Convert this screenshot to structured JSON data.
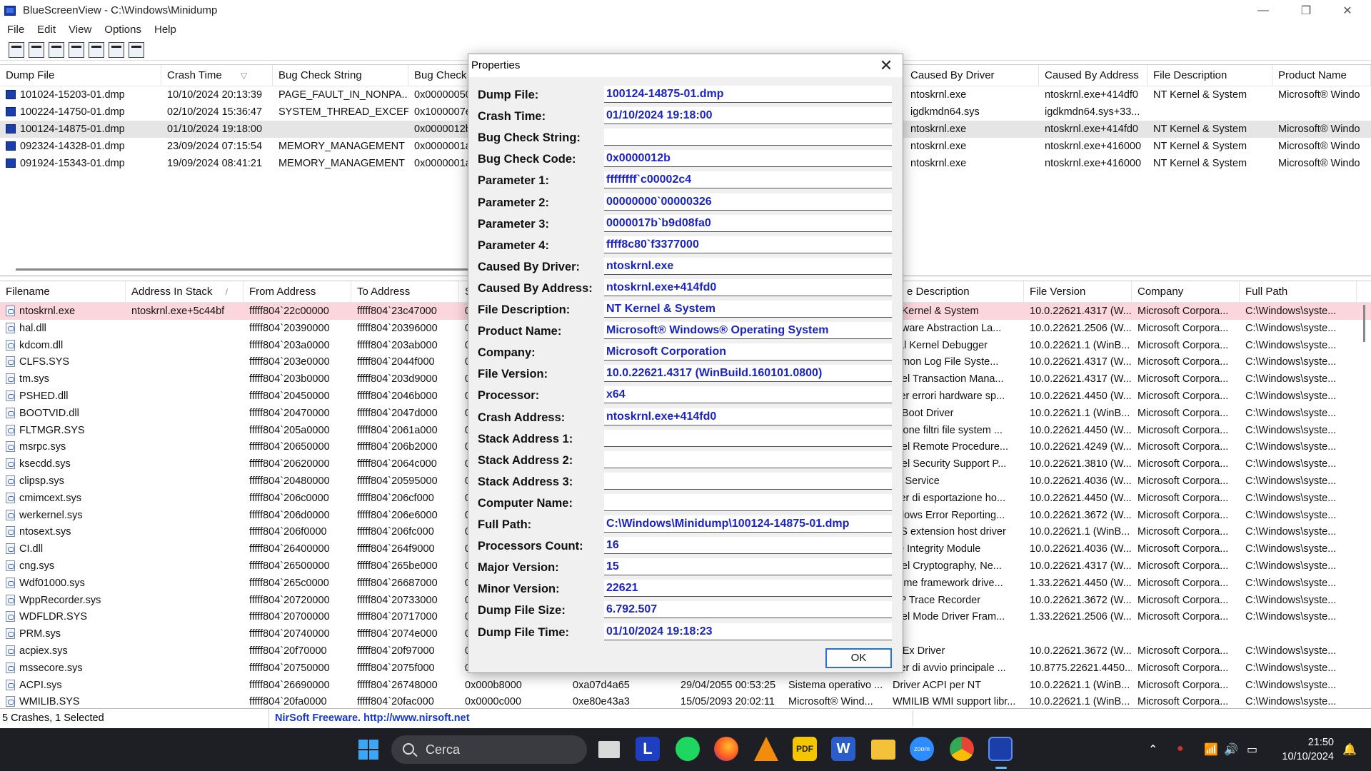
{
  "window": {
    "title": "BlueScreenView  -  C:\\Windows\\Minidump",
    "minimize": "—",
    "maximize": "❐",
    "close": "✕"
  },
  "menu": [
    "File",
    "Edit",
    "View",
    "Options",
    "Help"
  ],
  "toolbar_icons": [
    "properties-icon",
    "save-icon",
    "refresh-icon",
    "copy-icon",
    "html-report-icon",
    "find-icon",
    "exit-icon"
  ],
  "upper": {
    "headers": [
      "Dump File",
      "Crash Time",
      "Bug Check String",
      "Bug Check C",
      "Caused By Driver",
      "Caused By Address",
      "File Description",
      "Product Name"
    ],
    "sort_arrow": "▽",
    "rows": [
      {
        "dump": "101024-15203-01.dmp",
        "time": "10/10/2024 20:13:39",
        "bcs": "PAGE_FAULT_IN_NONPA...",
        "bcc": "0x00000050",
        "driver": "ntoskrnl.exe",
        "addr": "ntoskrnl.exe+414df0",
        "desc": "NT Kernel & System",
        "prod": "Microsoft® Windo"
      },
      {
        "dump": "100224-14750-01.dmp",
        "time": "02/10/2024 15:36:47",
        "bcs": "SYSTEM_THREAD_EXCEP...",
        "bcc": "0x1000007e",
        "driver": "igdkmdn64.sys",
        "addr": "igdkmdn64.sys+33...",
        "desc": "",
        "prod": ""
      },
      {
        "dump": "100124-14875-01.dmp",
        "time": "01/10/2024 19:18:00",
        "bcs": "",
        "bcc": "0x0000012b",
        "driver": "ntoskrnl.exe",
        "addr": "ntoskrnl.exe+414fd0",
        "desc": "NT Kernel & System",
        "prod": "Microsoft® Windo"
      },
      {
        "dump": "092324-14328-01.dmp",
        "time": "23/09/2024 07:15:54",
        "bcs": "MEMORY_MANAGEMENT",
        "bcc": "0x0000001a",
        "driver": "ntoskrnl.exe",
        "addr": "ntoskrnl.exe+416000",
        "desc": "NT Kernel & System",
        "prod": "Microsoft® Windo"
      },
      {
        "dump": "091924-15343-01.dmp",
        "time": "19/09/2024 08:41:21",
        "bcs": "MEMORY_MANAGEMENT",
        "bcc": "0x0000001a",
        "driver": "ntoskrnl.exe",
        "addr": "ntoskrnl.exe+416000",
        "desc": "NT Kernel & System",
        "prod": "Microsoft® Windo"
      }
    ]
  },
  "lower": {
    "headers": [
      "Filename",
      "Address In Stack",
      "From Address",
      "To Address",
      "S",
      "e Description",
      "File Version",
      "Company",
      "Full Path"
    ],
    "sort_arrow": "/",
    "rows": [
      {
        "file": "ntoskrnl.exe",
        "stack": "ntoskrnl.exe+5c44bf",
        "from": "fffff804`22c00000",
        "to": "fffff804`23c47000",
        "s": "0",
        "size": "",
        "ts": "",
        "fdesc": "",
        "desc": "T Kernel & System",
        "ver": "10.0.22621.4317 (W...",
        "comp": "Microsoft Corpora...",
        "path": "C:\\Windows\\syste..."
      },
      {
        "file": "hal.dll",
        "stack": "",
        "from": "fffff804`20390000",
        "to": "fffff804`20396000",
        "s": "0",
        "size": "",
        "ts": "",
        "fdesc": "",
        "desc": "rdware Abstraction La...",
        "ver": "10.0.22621.2506 (W...",
        "comp": "Microsoft Corpora...",
        "path": "C:\\Windows\\syste..."
      },
      {
        "file": "kdcom.dll",
        "stack": "",
        "from": "fffff804`203a0000",
        "to": "fffff804`203ab000",
        "s": "0",
        "size": "",
        "ts": "",
        "fdesc": "",
        "desc": "rial Kernel Debugger",
        "ver": "10.0.22621.1 (WinB...",
        "comp": "Microsoft Corpora...",
        "path": "C:\\Windows\\syste..."
      },
      {
        "file": "CLFS.SYS",
        "stack": "",
        "from": "fffff804`203e0000",
        "to": "fffff804`2044f000",
        "s": "0",
        "size": "",
        "ts": "",
        "fdesc": "",
        "desc": "mmon Log File Syste...",
        "ver": "10.0.22621.4317 (W...",
        "comp": "Microsoft Corpora...",
        "path": "C:\\Windows\\syste..."
      },
      {
        "file": "tm.sys",
        "stack": "",
        "from": "fffff804`203b0000",
        "to": "fffff804`203d9000",
        "s": "0",
        "size": "",
        "ts": "",
        "fdesc": "",
        "desc": "rnel Transaction Mana...",
        "ver": "10.0.22621.4317 (W...",
        "comp": "Microsoft Corpora...",
        "path": "C:\\Windows\\syste..."
      },
      {
        "file": "PSHED.dll",
        "stack": "",
        "from": "fffff804`20450000",
        "to": "fffff804`2046b000",
        "s": "0",
        "size": "",
        "ts": "",
        "fdesc": "",
        "desc": "iver errori hardware sp...",
        "ver": "10.0.22621.4450 (W...",
        "comp": "Microsoft Corpora...",
        "path": "C:\\Windows\\syste..."
      },
      {
        "file": "BOOTVID.dll",
        "stack": "",
        "from": "fffff804`20470000",
        "to": "fffff804`2047d000",
        "s": "0",
        "size": "",
        "ts": "",
        "fdesc": "",
        "desc": "A Boot Driver",
        "ver": "10.0.22621.1 (WinB...",
        "comp": "Microsoft Corpora...",
        "path": "C:\\Windows\\syste..."
      },
      {
        "file": "FLTMGR.SYS",
        "stack": "",
        "from": "fffff804`205a0000",
        "to": "fffff804`2061a000",
        "s": "0",
        "size": "",
        "ts": "",
        "fdesc": "",
        "desc": "stione filtri file system ...",
        "ver": "10.0.22621.4450 (W...",
        "comp": "Microsoft Corpora...",
        "path": "C:\\Windows\\syste..."
      },
      {
        "file": "msrpc.sys",
        "stack": "",
        "from": "fffff804`20650000",
        "to": "fffff804`206b2000",
        "s": "0",
        "size": "",
        "ts": "",
        "fdesc": "",
        "desc": "rnel Remote Procedure...",
        "ver": "10.0.22621.4249 (W...",
        "comp": "Microsoft Corpora...",
        "path": "C:\\Windows\\syste..."
      },
      {
        "file": "ksecdd.sys",
        "stack": "",
        "from": "fffff804`20620000",
        "to": "fffff804`2064c000",
        "s": "0",
        "size": "",
        "ts": "",
        "fdesc": "",
        "desc": "rnel Security Support P...",
        "ver": "10.0.22621.3810 (W...",
        "comp": "Microsoft Corpora...",
        "path": "C:\\Windows\\syste..."
      },
      {
        "file": "clipsp.sys",
        "stack": "",
        "from": "fffff804`20480000",
        "to": "fffff804`20595000",
        "s": "0",
        "size": "",
        "ts": "",
        "fdesc": "",
        "desc": "IP Service",
        "ver": "10.0.22621.4036 (W...",
        "comp": "Microsoft Corpora...",
        "path": "C:\\Windows\\syste..."
      },
      {
        "file": "cmimcext.sys",
        "stack": "",
        "from": "fffff804`206c0000",
        "to": "fffff804`206cf000",
        "s": "0",
        "size": "",
        "ts": "",
        "fdesc": "",
        "desc": "iver di esportazione ho...",
        "ver": "10.0.22621.4450 (W...",
        "comp": "Microsoft Corpora...",
        "path": "C:\\Windows\\syste..."
      },
      {
        "file": "werkernel.sys",
        "stack": "",
        "from": "fffff804`206d0000",
        "to": "fffff804`206e6000",
        "s": "0",
        "size": "",
        "ts": "",
        "fdesc": "",
        "desc": "ndows Error Reporting...",
        "ver": "10.0.22621.3672 (W...",
        "comp": "Microsoft Corpora...",
        "path": "C:\\Windows\\syste..."
      },
      {
        "file": "ntosext.sys",
        "stack": "",
        "from": "fffff804`206f0000",
        "to": "fffff804`206fc000",
        "s": "0",
        "size": "",
        "ts": "",
        "fdesc": "",
        "desc": "OS extension host driver",
        "ver": "10.0.22621.1 (WinB...",
        "comp": "Microsoft Corpora...",
        "path": "C:\\Windows\\syste..."
      },
      {
        "file": "CI.dll",
        "stack": "",
        "from": "fffff804`26400000",
        "to": "fffff804`264f9000",
        "s": "0",
        "size": "",
        "ts": "",
        "fdesc": "",
        "desc": "de Integrity Module",
        "ver": "10.0.22621.4036 (W...",
        "comp": "Microsoft Corpora...",
        "path": "C:\\Windows\\syste..."
      },
      {
        "file": "cng.sys",
        "stack": "",
        "from": "fffff804`26500000",
        "to": "fffff804`265be000",
        "s": "0",
        "size": "",
        "ts": "",
        "fdesc": "",
        "desc": "rnel Cryptography, Ne...",
        "ver": "10.0.22621.4317 (W...",
        "comp": "Microsoft Corpora...",
        "path": "C:\\Windows\\syste..."
      },
      {
        "file": "Wdf01000.sys",
        "stack": "",
        "from": "fffff804`265c0000",
        "to": "fffff804`26687000",
        "s": "0",
        "size": "",
        "ts": "",
        "fdesc": "",
        "desc": "ntime framework drive...",
        "ver": "1.33.22621.4450 (W...",
        "comp": "Microsoft Corpora...",
        "path": "C:\\Windows\\syste..."
      },
      {
        "file": "WppRecorder.sys",
        "stack": "",
        "from": "fffff804`20720000",
        "to": "fffff804`20733000",
        "s": "0",
        "size": "",
        "ts": "",
        "fdesc": "",
        "desc": "PP Trace Recorder",
        "ver": "10.0.22621.3672 (W...",
        "comp": "Microsoft Corpora...",
        "path": "C:\\Windows\\syste..."
      },
      {
        "file": "WDFLDR.SYS",
        "stack": "",
        "from": "fffff804`20700000",
        "to": "fffff804`20717000",
        "s": "0",
        "size": "",
        "ts": "",
        "fdesc": "",
        "desc": "rnel Mode Driver Fram...",
        "ver": "1.33.22621.2506 (W...",
        "comp": "Microsoft Corpora...",
        "path": "C:\\Windows\\syste..."
      },
      {
        "file": "PRM.sys",
        "stack": "",
        "from": "fffff804`20740000",
        "to": "fffff804`2074e000",
        "s": "0",
        "size": "",
        "ts": "",
        "fdesc": "",
        "desc": "",
        "ver": "",
        "comp": "",
        "path": ""
      },
      {
        "file": "acpiex.sys",
        "stack": "",
        "from": "fffff804`20f70000",
        "to": "fffff804`20f97000",
        "s": "0",
        "size": "",
        "ts": "",
        "fdesc": "",
        "desc": "PIEx Driver",
        "ver": "10.0.22621.3672 (W...",
        "comp": "Microsoft Corpora...",
        "path": "C:\\Windows\\syste..."
      },
      {
        "file": "mssecore.sys",
        "stack": "",
        "from": "fffff804`20750000",
        "to": "fffff804`2075f000",
        "s": "0",
        "size": "",
        "ts": "",
        "fdesc": "",
        "desc": "iver di avvio principale ...",
        "ver": "10.8775.22621.4450...",
        "comp": "Microsoft Corpora...",
        "path": "C:\\Windows\\syste..."
      },
      {
        "file": "ACPI.sys",
        "stack": "",
        "from": "fffff804`26690000",
        "to": "fffff804`26748000",
        "s": "0x000b8000",
        "size": "0xa07d4a65",
        "ts": "29/04/2055 00:53:25",
        "fdesc": "Sistema operativo ...",
        "desc": "Driver ACPI per NT",
        "ver": "10.0.22621.1 (WinB...",
        "comp": "Microsoft Corpora...",
        "path": "C:\\Windows\\syste..."
      },
      {
        "file": "WMILIB.SYS",
        "stack": "",
        "from": "fffff804`20fa0000",
        "to": "fffff804`20fac000",
        "s": "0x0000c000",
        "size": "0xe80e43a3",
        "ts": "15/05/2093 20:02:11",
        "fdesc": "Microsoft® Wind...",
        "desc": "WMILIB WMI support libr...",
        "ver": "10.0.22621.1 (WinB...",
        "comp": "Microsoft Corpora...",
        "path": "C:\\Windows\\syste..."
      }
    ]
  },
  "status": {
    "left": "5 Crashes, 1 Selected",
    "link": "NirSoft Freeware.  http://www.nirsoft.net"
  },
  "dialog": {
    "title": "Properties",
    "close": "✕",
    "ok": "OK",
    "props": [
      {
        "label": "Dump File:",
        "value": "100124-14875-01.dmp"
      },
      {
        "label": "Crash Time:",
        "value": "01/10/2024 19:18:00"
      },
      {
        "label": "Bug Check String:",
        "value": ""
      },
      {
        "label": "Bug Check Code:",
        "value": "0x0000012b"
      },
      {
        "label": "Parameter 1:",
        "value": "ffffffff`c00002c4"
      },
      {
        "label": "Parameter 2:",
        "value": "00000000`00000326"
      },
      {
        "label": "Parameter 3:",
        "value": "0000017b`b9d08fa0"
      },
      {
        "label": "Parameter 4:",
        "value": "ffff8c80`f3377000"
      },
      {
        "label": "Caused By Driver:",
        "value": "ntoskrnl.exe"
      },
      {
        "label": "Caused By Address:",
        "value": "ntoskrnl.exe+414fd0"
      },
      {
        "label": "File Description:",
        "value": "NT Kernel & System"
      },
      {
        "label": "Product Name:",
        "value": "Microsoft® Windows® Operating System"
      },
      {
        "label": "Company:",
        "value": "Microsoft Corporation"
      },
      {
        "label": "File Version:",
        "value": "10.0.22621.4317 (WinBuild.160101.0800)"
      },
      {
        "label": "Processor:",
        "value": "x64"
      },
      {
        "label": "Crash Address:",
        "value": "ntoskrnl.exe+414fd0"
      },
      {
        "label": "Stack Address 1:",
        "value": ""
      },
      {
        "label": "Stack Address 2:",
        "value": ""
      },
      {
        "label": "Stack Address 3:",
        "value": ""
      },
      {
        "label": "Computer Name:",
        "value": ""
      },
      {
        "label": "Full Path:",
        "value": "C:\\Windows\\Minidump\\100124-14875-01.dmp"
      },
      {
        "label": "Processors Count:",
        "value": "16"
      },
      {
        "label": "Major Version:",
        "value": "15"
      },
      {
        "label": "Minor Version:",
        "value": "22621"
      },
      {
        "label": "Dump File Size:",
        "value": "6.792.507"
      },
      {
        "label": "Dump File Time:",
        "value": "01/10/2024 19:18:23"
      }
    ]
  },
  "taskbar": {
    "search": "Cerca",
    "time": "21:50",
    "date": "10/10/2024",
    "l_app_letter": "L",
    "pdf_label": "PDF",
    "word_letter": "W",
    "zoom_label": "zoom",
    "apps": [
      "task-view-icon",
      "l-app-icon",
      "spotify-icon",
      "firefox-icon",
      "vlc-icon",
      "pdf-app-icon",
      "word-icon",
      "file-explorer-icon",
      "zoom-icon",
      "chrome-icon",
      "bluescreenview-icon"
    ],
    "tray": [
      "chevron-up-icon",
      "vpn-icon",
      "wifi-icon",
      "volume-icon",
      "battery-icon",
      "notification-bell-icon"
    ],
    "tray_glyphs": [
      "⌃",
      "●",
      "📶",
      "🔊",
      "▭",
      "🔔"
    ]
  },
  "colors": {
    "accent": "#2a6fd4",
    "value_text": "#1a23c8",
    "highlight_row": "#fbd6dd",
    "selected_row": "#e5e5e5",
    "taskbar": "#1e1f24"
  }
}
